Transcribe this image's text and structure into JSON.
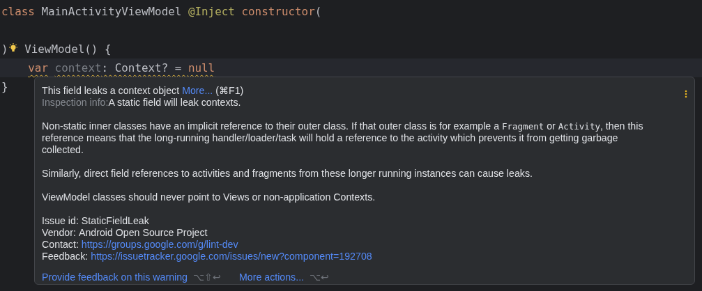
{
  "editor": {
    "lines": [
      {
        "kind": "code",
        "current": false,
        "warning": false,
        "bulb": false,
        "tokens": [
          {
            "kind": "keyword",
            "text": "class"
          },
          {
            "kind": "plain",
            "text": " MainActivityViewModel"
          },
          {
            "kind": "annotation",
            "text": " @Inject"
          },
          {
            "kind": "keyword",
            "text": " constructor"
          },
          {
            "kind": "plain",
            "text": "("
          }
        ]
      },
      {
        "kind": "blank"
      },
      {
        "kind": "code",
        "current": false,
        "warning": false,
        "bulb": true,
        "tokens": [
          {
            "kind": "plain",
            "text": ")"
          },
          {
            "kind": "plain",
            "text": " ViewModel() {"
          }
        ]
      },
      {
        "kind": "code",
        "current": true,
        "warning": true,
        "bulb": false,
        "tokens": [
          {
            "kind": "keyword",
            "text": "    var"
          },
          {
            "kind": "unused",
            "text": " context"
          },
          {
            "kind": "plain",
            "text": ": Context? = "
          },
          {
            "kind": "keyword",
            "text": "null"
          }
        ]
      },
      {
        "kind": "code",
        "current": false,
        "warning": false,
        "bulb": false,
        "tokens": [
          {
            "kind": "plain",
            "text": "}"
          }
        ]
      }
    ]
  },
  "popup": {
    "headline": {
      "text": "This field leaks a context object",
      "link": "More...",
      "shortcut": "(⌘F1)"
    },
    "info": {
      "label": "Inspection info:",
      "text": "A static field will leak contexts."
    },
    "paragraphs": [
      [
        {
          "kind": "text",
          "text": "Non-static inner classes have an implicit reference to their outer class. If that outer class is for example a "
        },
        {
          "kind": "code",
          "text": "Fragment"
        },
        {
          "kind": "text",
          "text": " or "
        },
        {
          "kind": "code",
          "text": "Activity"
        },
        {
          "kind": "text",
          "text": ", then this reference means that the long-running handler/loader/task will hold a reference to the activity which prevents it from getting garbage collected."
        }
      ],
      [
        {
          "kind": "text",
          "text": "Similarly, direct field references to activities and fragments from these longer running instances can cause leaks."
        }
      ],
      [
        {
          "kind": "text",
          "text": "ViewModel classes should never point to Views or non-application Contexts."
        }
      ]
    ],
    "details": [
      {
        "kind": "text",
        "label": "Issue id:",
        "value": "StaticFieldLeak"
      },
      {
        "kind": "text",
        "label": "Vendor:",
        "value": "Android Open Source Project"
      },
      {
        "kind": "link",
        "label": "Contact:",
        "value": "https://groups.google.com/g/lint-dev"
      },
      {
        "kind": "link",
        "label": "Feedback:",
        "value": "https://issuetracker.google.com/issues/new?component=192708"
      }
    ],
    "actions": [
      {
        "label": "Provide feedback on this warning",
        "shortcut": "⌥⇧↩"
      },
      {
        "label": "More actions...",
        "shortcut": "⌥↩"
      }
    ]
  }
}
